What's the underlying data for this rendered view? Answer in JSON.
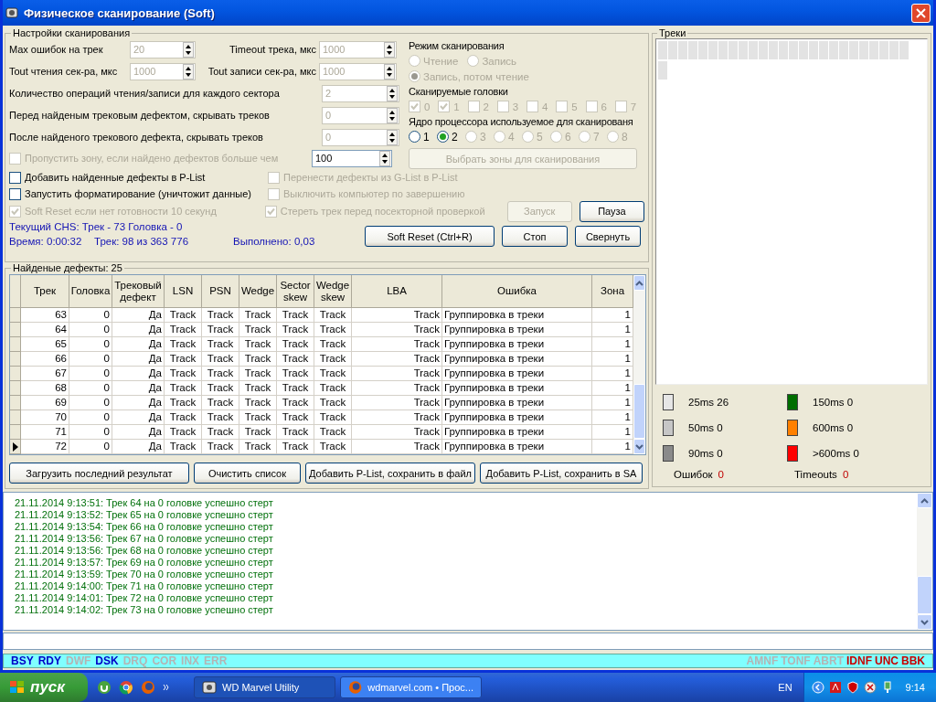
{
  "window": {
    "title": "Физическое сканирование (Soft)"
  },
  "settings": {
    "title": "Настройки сканирования",
    "spin_pairs": [
      {
        "label": "Max ошибок на трек",
        "value": "20",
        "disabled": true,
        "label_2": "Timeout трека, мкс",
        "value_2": "1000",
        "disabled_2": true
      },
      {
        "label": "Tout чтения сек-ра, мкс",
        "value": "1000",
        "disabled": true,
        "label_2": "Tout записи сек-ра, мкс",
        "value_2": "1000",
        "disabled_2": true
      }
    ],
    "spins": [
      {
        "label": "Количество операций чтения/записи для каждого сектора",
        "value": "2",
        "disabled": true
      },
      {
        "label": "Перед найденым трековым дефектом, скрывать треков",
        "value": "0",
        "disabled": true
      },
      {
        "label": "После найденого трекового дефекта, скрывать треков",
        "value": "0",
        "disabled": true
      }
    ],
    "skip_zone": {
      "label": "Пропустить зону, если найдено дефектов больше чем",
      "checked": false,
      "disabled": true,
      "value": "100",
      "value_disabled": false
    },
    "options_left": [
      {
        "label": "Добавить найденные дефекты в P-List",
        "checked": false,
        "disabled": false
      },
      {
        "label": "Запустить форматирование (уничтожит данные)",
        "checked": false,
        "disabled": false
      },
      {
        "label": "Soft Reset если нет готовности 10 секунд",
        "checked": true,
        "disabled": true
      }
    ],
    "options_right": [
      {
        "label": "Перенести дефекты из G-List в P-List",
        "checked": false,
        "disabled": true
      },
      {
        "label": "Выключить компьютер по завершению",
        "checked": false,
        "disabled": true
      },
      {
        "label": "Стереть трек перед посекторной проверкой",
        "checked": true,
        "disabled": true
      }
    ],
    "chs": "Текущий CHS: Трек - 73 Головка - 0",
    "time": "Время: 0:00:32",
    "track": "Трек: 98 из 363 776",
    "done": "Выполнено: 0,03",
    "buttons": [
      {
        "label": "Запуск",
        "disabled": true
      },
      {
        "label": "Пауза",
        "disabled": false
      },
      {
        "label": "Soft Reset (Ctrl+R)",
        "disabled": false
      },
      {
        "label": "Стоп",
        "disabled": false
      },
      {
        "label": "Свернуть",
        "disabled": false
      }
    ],
    "mode": {
      "title": "Режим сканирования",
      "options": [
        {
          "label": "Чтение",
          "selected": false,
          "disabled": true
        },
        {
          "label": "Запись",
          "selected": false,
          "disabled": true
        },
        {
          "label": "Запись, потом чтение",
          "selected": true,
          "disabled": true
        }
      ]
    },
    "heads": {
      "title": "Сканируемые головки",
      "items": [
        {
          "label": "0",
          "checked": true,
          "disabled": true
        },
        {
          "label": "1",
          "checked": true,
          "disabled": true
        },
        {
          "label": "2",
          "checked": false,
          "disabled": true
        },
        {
          "label": "3",
          "checked": false,
          "disabled": true
        },
        {
          "label": "4",
          "checked": false,
          "disabled": true
        },
        {
          "label": "5",
          "checked": false,
          "disabled": true
        },
        {
          "label": "6",
          "checked": false,
          "disabled": true
        },
        {
          "label": "7",
          "checked": false,
          "disabled": true
        }
      ]
    },
    "cores": {
      "title": "Ядро процессора используемое для сканированя",
      "items": [
        {
          "label": "1",
          "selected": false,
          "disabled": false
        },
        {
          "label": "2",
          "selected": true,
          "disabled": false
        },
        {
          "label": "3",
          "selected": false,
          "disabled": true
        },
        {
          "label": "4",
          "selected": false,
          "disabled": true
        },
        {
          "label": "5",
          "selected": false,
          "disabled": true
        },
        {
          "label": "6",
          "selected": false,
          "disabled": true
        },
        {
          "label": "7",
          "selected": false,
          "disabled": true
        },
        {
          "label": "8",
          "selected": false,
          "disabled": true
        }
      ]
    },
    "zones_button": {
      "label": "Выбрать зоны для сканирования",
      "disabled": true
    }
  },
  "defects": {
    "title": "Найденые дефекты: 25",
    "columns": [
      "Трек",
      "Головка",
      "Трековый дефект",
      "LSN",
      "PSN",
      "Wedge",
      "Sector skew",
      "Wedge skew",
      "LBA",
      "Ошибка",
      "Зона"
    ],
    "rows": [
      {
        "cells": [
          "63",
          "0",
          "Да",
          "Track",
          "Track",
          "Track",
          "Track",
          "Track",
          "Track",
          "Группировка в треки",
          "1"
        ],
        "current": false
      },
      {
        "cells": [
          "64",
          "0",
          "Да",
          "Track",
          "Track",
          "Track",
          "Track",
          "Track",
          "Track",
          "Группировка в треки",
          "1"
        ],
        "current": false
      },
      {
        "cells": [
          "65",
          "0",
          "Да",
          "Track",
          "Track",
          "Track",
          "Track",
          "Track",
          "Track",
          "Группировка в треки",
          "1"
        ],
        "current": false
      },
      {
        "cells": [
          "66",
          "0",
          "Да",
          "Track",
          "Track",
          "Track",
          "Track",
          "Track",
          "Track",
          "Группировка в треки",
          "1"
        ],
        "current": false
      },
      {
        "cells": [
          "67",
          "0",
          "Да",
          "Track",
          "Track",
          "Track",
          "Track",
          "Track",
          "Track",
          "Группировка в треки",
          "1"
        ],
        "current": false
      },
      {
        "cells": [
          "68",
          "0",
          "Да",
          "Track",
          "Track",
          "Track",
          "Track",
          "Track",
          "Track",
          "Группировка в треки",
          "1"
        ],
        "current": false
      },
      {
        "cells": [
          "69",
          "0",
          "Да",
          "Track",
          "Track",
          "Track",
          "Track",
          "Track",
          "Track",
          "Группировка в треки",
          "1"
        ],
        "current": false
      },
      {
        "cells": [
          "70",
          "0",
          "Да",
          "Track",
          "Track",
          "Track",
          "Track",
          "Track",
          "Track",
          "Группировка в треки",
          "1"
        ],
        "current": false
      },
      {
        "cells": [
          "71",
          "0",
          "Да",
          "Track",
          "Track",
          "Track",
          "Track",
          "Track",
          "Track",
          "Группировка в треки",
          "1"
        ],
        "current": false
      },
      {
        "cells": [
          "72",
          "0",
          "Да",
          "Track",
          "Track",
          "Track",
          "Track",
          "Track",
          "Track",
          "Группировка в треки",
          "1"
        ],
        "current": true
      }
    ],
    "buttons": [
      "Загрузить последний результат",
      "Очистить список",
      "Добавить P-List, сохранить в файл",
      "Добавить P-List, сохранить в SA"
    ]
  },
  "tracks": {
    "title": "Треки",
    "legend": [
      {
        "label": "25ms 26",
        "color": "#e6e6e6"
      },
      {
        "label": "150ms 0",
        "color": "#006e00"
      },
      {
        "label": "50ms 0",
        "color": "#c6c6c6"
      },
      {
        "label": "600ms 0",
        "color": "#ff8000"
      },
      {
        "label": "90ms 0",
        "color": "#8a8a8a"
      },
      {
        "label": ">600ms 0",
        "color": "#ff0000"
      }
    ],
    "errors_label": "Ошибок",
    "errors": "0",
    "timeouts_label": "Timeouts",
    "timeouts": "0"
  },
  "log": [
    "21.11.2014 9:13:51: Трек 64 на 0 головке успешно стерт",
    "21.11.2014 9:13:52: Трек 65 на 0 головке успешно стерт",
    "21.11.2014 9:13:54: Трек 66 на 0 головке успешно стерт",
    "21.11.2014 9:13:56: Трек 67 на 0 головке успешно стерт",
    "21.11.2014 9:13:56: Трек 68 на 0 головке успешно стерт",
    "21.11.2014 9:13:57: Трек 69 на 0 головке успешно стерт",
    "21.11.2014 9:13:59: Трек 70 на 0 головке успешно стерт",
    "21.11.2014 9:14:00: Трек 71 на 0 головке успешно стерт",
    "21.11.2014 9:14:01: Трек 72 на 0 головке успешно стерт",
    "21.11.2014 9:14:02: Трек 73 на 0 головке успешно стерт"
  ],
  "flags_left": [
    {
      "label": "BSY",
      "active": true
    },
    {
      "label": "RDY",
      "active": true
    },
    {
      "label": "DWF",
      "active": false
    },
    {
      "label": "DSK",
      "active": true
    },
    {
      "label": "DRQ",
      "active": false
    },
    {
      "label": "COR",
      "active": false
    },
    {
      "label": "INX",
      "active": false
    },
    {
      "label": "ERR",
      "active": false
    }
  ],
  "flags_right": [
    {
      "label": "AMNF",
      "active": false
    },
    {
      "label": "TONF",
      "active": false
    },
    {
      "label": "ABRT",
      "active": false
    },
    {
      "label": "IDNF",
      "active": true
    },
    {
      "label": "UNC",
      "active": true
    },
    {
      "label": "BBK",
      "active": true
    }
  ],
  "taskbar": {
    "start": "пуск",
    "tasks": [
      {
        "label": "WD Marvel Utility",
        "selected": true
      },
      {
        "label": "wdmarvel.com • Прос...",
        "selected": false
      }
    ],
    "lang": "EN",
    "time": "9:14"
  }
}
